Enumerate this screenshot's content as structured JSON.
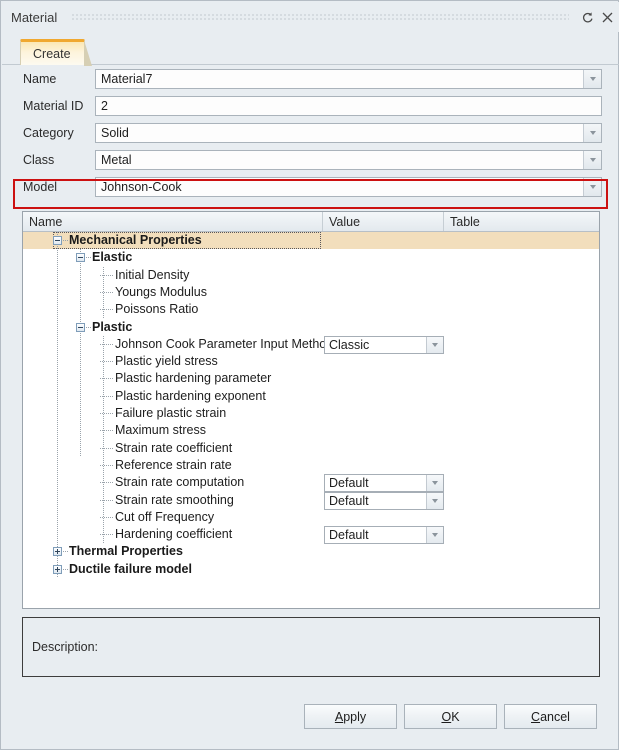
{
  "window": {
    "title": "Material",
    "controls": [
      {
        "name": "reset-icon",
        "label": "reset"
      },
      {
        "name": "close-icon",
        "label": "close"
      }
    ]
  },
  "tabs": [
    {
      "label": "Create",
      "active": true
    }
  ],
  "form": {
    "rows": [
      {
        "label": "Name",
        "value": "Material7",
        "has_dropdown": true
      },
      {
        "label": "Material ID",
        "value": "2",
        "has_dropdown": false
      },
      {
        "label": "Category",
        "value": "Solid",
        "has_dropdown": true
      },
      {
        "label": "Class",
        "value": "Metal",
        "has_dropdown": true
      },
      {
        "label": "Model",
        "value": "Johnson-Cook",
        "has_dropdown": true
      }
    ],
    "highlight_color": "#cc1111",
    "highlighted_row": "Model"
  },
  "tree": {
    "columns": [
      "Name",
      "Value",
      "Table"
    ],
    "rows": [
      {
        "label": "Mechanical Properties",
        "depth": 0,
        "bold": true,
        "expander": "minus",
        "selected": true,
        "value": ""
      },
      {
        "label": "Elastic",
        "depth": 1,
        "bold": true,
        "expander": "minus",
        "selected": false,
        "value": ""
      },
      {
        "label": "Initial Density",
        "depth": 2,
        "bold": false,
        "expander": "none",
        "selected": false,
        "value": ""
      },
      {
        "label": "Youngs Modulus",
        "depth": 2,
        "bold": false,
        "expander": "none",
        "selected": false,
        "value": ""
      },
      {
        "label": "Poissons Ratio",
        "depth": 2,
        "bold": false,
        "expander": "none",
        "selected": false,
        "value": ""
      },
      {
        "label": "Plastic",
        "depth": 1,
        "bold": true,
        "expander": "minus",
        "selected": false,
        "value": ""
      },
      {
        "label": "Johnson Cook Parameter Input Method",
        "depth": 2,
        "bold": false,
        "expander": "none",
        "selected": false,
        "value": "Classic"
      },
      {
        "label": "Plastic yield stress",
        "depth": 2,
        "bold": false,
        "expander": "none",
        "selected": false,
        "value": ""
      },
      {
        "label": "Plastic hardening parameter",
        "depth": 2,
        "bold": false,
        "expander": "none",
        "selected": false,
        "value": ""
      },
      {
        "label": "Plastic hardening exponent",
        "depth": 2,
        "bold": false,
        "expander": "none",
        "selected": false,
        "value": ""
      },
      {
        "label": "Failure plastic strain",
        "depth": 2,
        "bold": false,
        "expander": "none",
        "selected": false,
        "value": ""
      },
      {
        "label": "Maximum stress",
        "depth": 2,
        "bold": false,
        "expander": "none",
        "selected": false,
        "value": ""
      },
      {
        "label": "Strain rate coefficient",
        "depth": 2,
        "bold": false,
        "expander": "none",
        "selected": false,
        "value": ""
      },
      {
        "label": "Reference strain rate",
        "depth": 2,
        "bold": false,
        "expander": "none",
        "selected": false,
        "value": ""
      },
      {
        "label": "Strain rate computation",
        "depth": 2,
        "bold": false,
        "expander": "none",
        "selected": false,
        "value": "Default"
      },
      {
        "label": "Strain rate smoothing",
        "depth": 2,
        "bold": false,
        "expander": "none",
        "selected": false,
        "value": "Default"
      },
      {
        "label": "Cut off Frequency",
        "depth": 2,
        "bold": false,
        "expander": "none",
        "selected": false,
        "value": ""
      },
      {
        "label": "Hardening coefficient",
        "depth": 2,
        "bold": false,
        "expander": "none",
        "selected": false,
        "value": "Default"
      },
      {
        "label": "Thermal Properties",
        "depth": 0,
        "bold": true,
        "expander": "plus",
        "selected": false,
        "value": ""
      },
      {
        "label": "Ductile failure model",
        "depth": 0,
        "bold": true,
        "expander": "plus",
        "selected": false,
        "value": ""
      }
    ]
  },
  "description": {
    "label": "Description:",
    "text": ""
  },
  "buttons": [
    {
      "label": "Apply",
      "mnemonic_index": 0,
      "name": "apply-button"
    },
    {
      "label": "OK",
      "mnemonic_index": 0,
      "name": "ok-button"
    },
    {
      "label": "Cancel",
      "mnemonic_index": 0,
      "name": "cancel-button"
    }
  ]
}
